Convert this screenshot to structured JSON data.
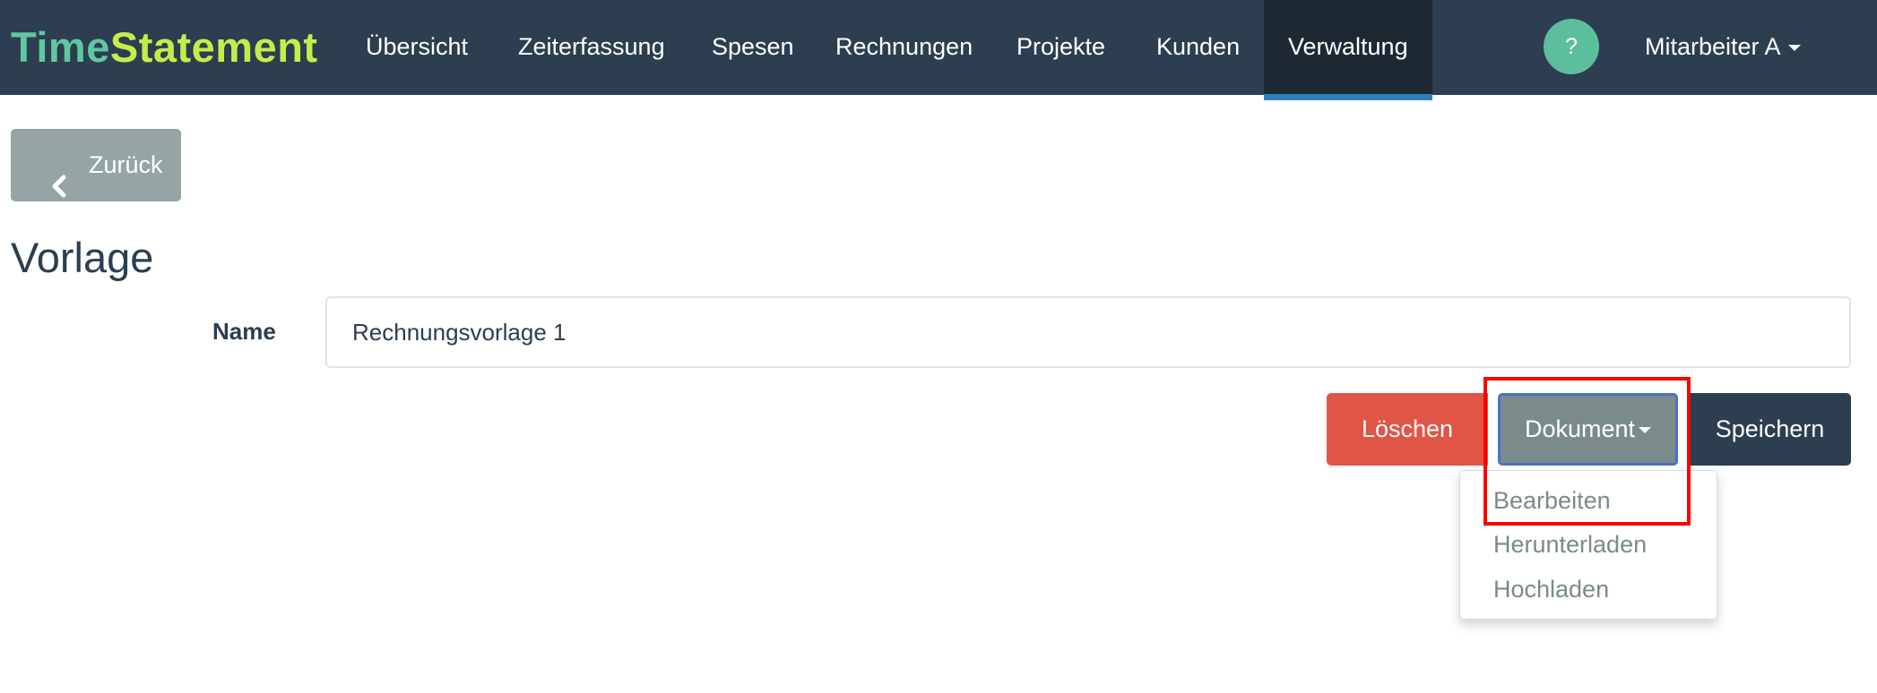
{
  "brand": {
    "part1": "Time",
    "part2": "Statement"
  },
  "nav": {
    "items": [
      {
        "label": "Übersicht"
      },
      {
        "label": "Zeiterfassung"
      },
      {
        "label": "Spesen"
      },
      {
        "label": "Rechnungen"
      },
      {
        "label": "Projekte"
      },
      {
        "label": "Kunden"
      },
      {
        "label": "Verwaltung",
        "active": true
      }
    ],
    "help_label": "?",
    "user_label": "Mitarbeiter A"
  },
  "back_button": {
    "label": "Zurück",
    "icon": "chevron-left-icon"
  },
  "page_title": "Vorlage",
  "form": {
    "name_label": "Name",
    "name_value": "Rechnungsvorlage 1"
  },
  "actions": {
    "delete_label": "Löschen",
    "document_label": "Dokument",
    "save_label": "Speichern"
  },
  "document_menu": {
    "items": [
      {
        "label": "Bearbeiten"
      },
      {
        "label": "Herunterladen"
      },
      {
        "label": "Hochladen"
      }
    ]
  },
  "colors": {
    "navbar": "#2c3e50",
    "brand_time": "#5fc8a0",
    "brand_statement": "#c6ec4a",
    "active_underline": "#2f7fb8",
    "help_circle": "#5cbf9c",
    "delete": "#e15546",
    "document": "#7b8a8b",
    "save": "#2c3e50",
    "back": "#95a5a6",
    "highlight": "#ff0000"
  }
}
